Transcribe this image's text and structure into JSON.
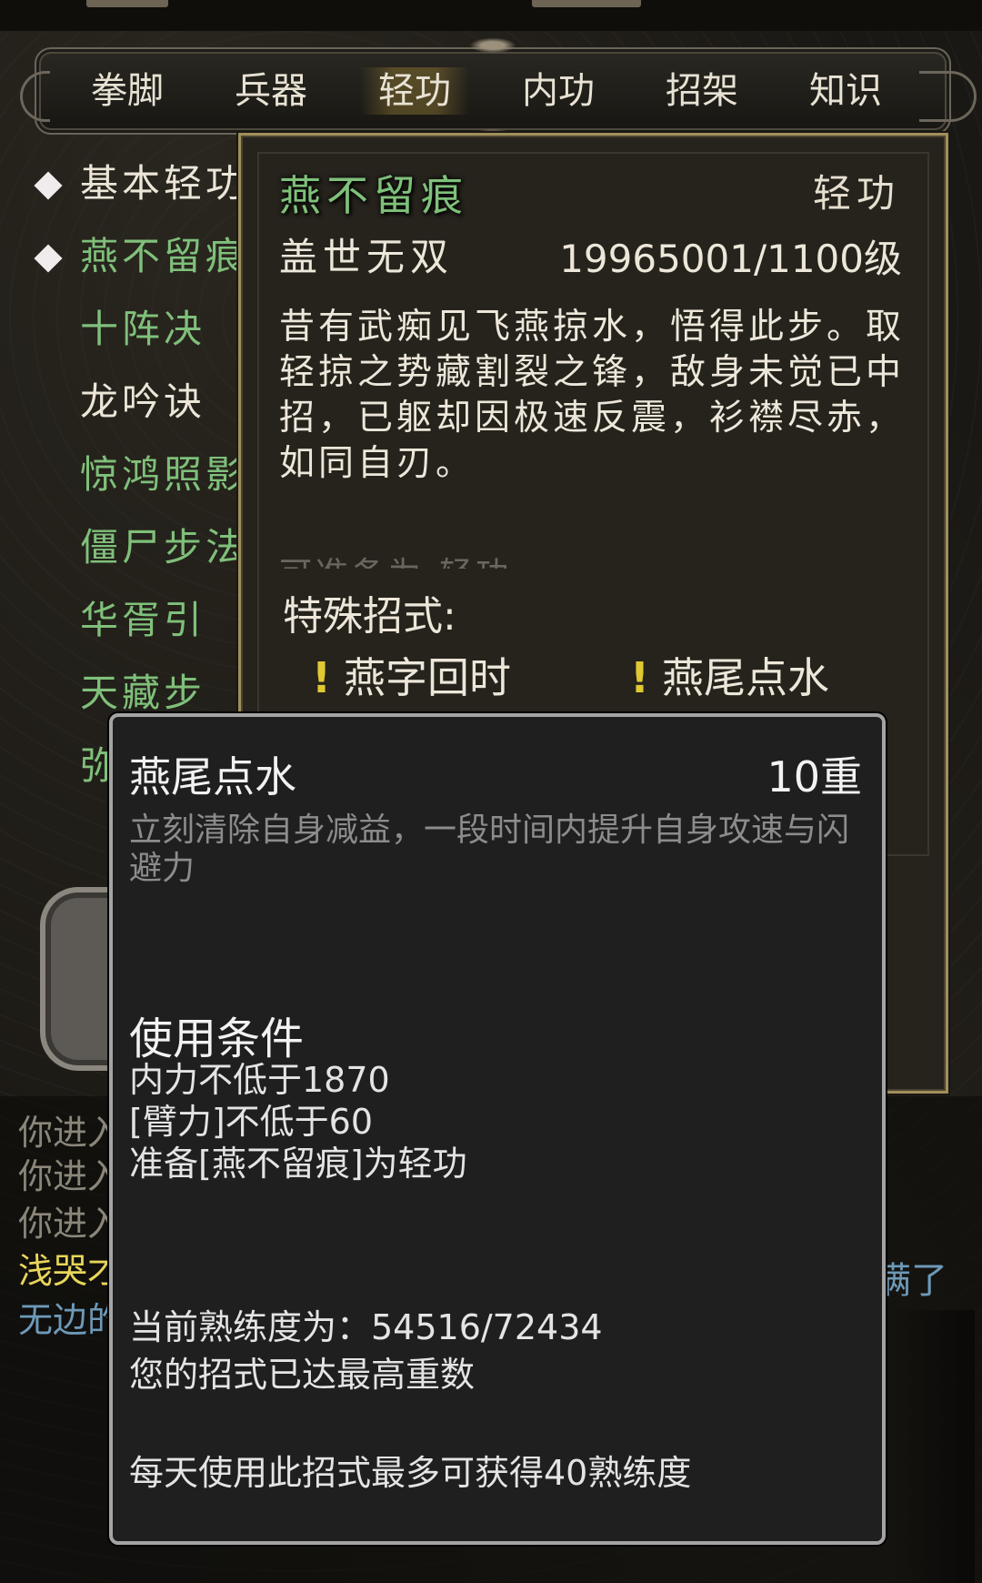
{
  "tabs": [
    "拳脚",
    "兵器",
    "轻功",
    "内功",
    "招架",
    "知识"
  ],
  "active_tab": "轻功",
  "skills": [
    {
      "label": "基本轻功",
      "color": "white",
      "selected": true
    },
    {
      "label": "燕不留痕",
      "color": "green",
      "selected": true
    },
    {
      "label": "十阵决",
      "color": "green",
      "selected": false
    },
    {
      "label": "龙吟诀",
      "color": "white",
      "selected": false
    },
    {
      "label": "惊鸿照影",
      "color": "green",
      "selected": false
    },
    {
      "label": "僵尸步法",
      "color": "green",
      "selected": false
    },
    {
      "label": "华胥引",
      "color": "green",
      "selected": false
    },
    {
      "label": "天藏步",
      "color": "green",
      "selected": false
    },
    {
      "label": "弥",
      "color": "green",
      "selected": false
    }
  ],
  "detail": {
    "name": "燕不留痕",
    "category": "轻功",
    "rank": "盖世无双",
    "level": "19965001/1100级",
    "description": "昔有武痴见飞燕掠水，悟得此步。取轻掠之势藏割裂之锋，敌身未觉已中招，已躯却因极速反震，衫襟尽赤，如同自刃。",
    "cut_line": "可准备为:轻功",
    "special_title": "特殊招式:",
    "moves": [
      "燕字回时",
      "燕尾点水"
    ]
  },
  "popup": {
    "title": "燕尾点水",
    "level": "10重",
    "description": "立刻清除自身减益，一段时间内提升自身攻速与闪避力",
    "cond_title": "使用条件",
    "conditions": [
      "内力不低于1870",
      "[臂力]不低于60",
      "准备[燕不留痕]为轻功"
    ],
    "proficiency": "当前熟练度为：54516/72434",
    "max_note": "您的招式已达最高重数",
    "daily_note": "每天使用此招式最多可获得40熟练度"
  },
  "log": {
    "lines": [
      {
        "text": "你进入",
        "color": "gray"
      },
      {
        "text": "你进入",
        "color": "gray"
      },
      {
        "text": "你进入",
        "color": "gray"
      },
      {
        "text": "浅哭才",
        "color": "yellow"
      },
      {
        "text": "无边的",
        "color": "blue"
      }
    ],
    "right_fragment": "满了"
  },
  "colors": {
    "skill_green": "#7fc07a",
    "panel_border": "#a08f5c",
    "popup_bg": "#1f1f1f"
  }
}
